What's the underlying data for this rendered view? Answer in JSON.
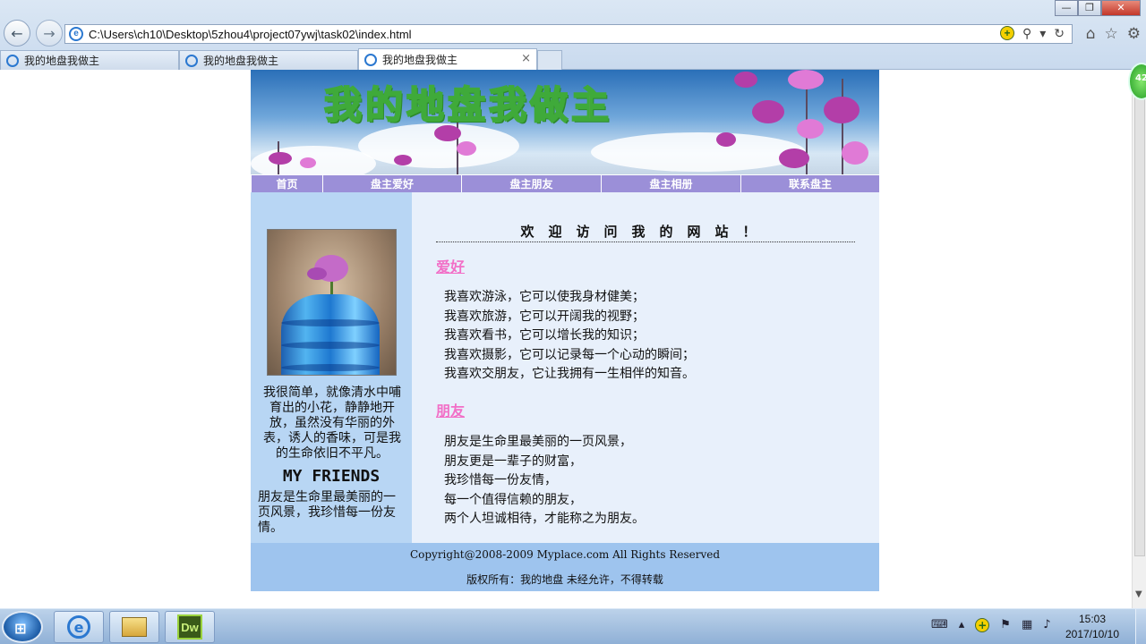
{
  "browser": {
    "address": "C:\\Users\\ch10\\Desktop\\5zhou4\\project07ywj\\task02\\index.html",
    "tabs": [
      {
        "title": "我的地盘我做主"
      },
      {
        "title": "我的地盘我做主"
      },
      {
        "title": "我的地盘我做主"
      }
    ],
    "close_glyph": "×",
    "badge": "42"
  },
  "site": {
    "banner_title": "我的地盘我做主",
    "nav": [
      "首页",
      "盘主爱好",
      "盘主朋友",
      "盘主相册",
      "联系盘主"
    ],
    "sidebar": {
      "intro": "我很简单，就像清水中哺育出的小花，静静地开放，虽然没有华丽的外表，诱人的香味，可是我的生命依旧不平凡。",
      "friends_title": "MY FRIENDS",
      "friends_text": "朋友是生命里最美丽的一页风景，我珍惜每一份友情。"
    },
    "main": {
      "welcome": "欢迎访问我的网站！",
      "hobby_title": "爱好",
      "hobbies": [
        "我喜欢游泳，它可以使我身材健美；",
        "我喜欢旅游，它可以开阔我的视野；",
        "我喜欢看书，它可以增长我的知识；",
        "我喜欢摄影，它可以记录每一个心动的瞬间；",
        "我喜欢交朋友，它让我拥有一生相伴的知音。"
      ],
      "friends_title": "朋友",
      "friends": [
        "朋友是生命里最美丽的一页风景，",
        "朋友更是一辈子的财富，",
        "我珍惜每一份友情，",
        "每一个值得信赖的朋友，",
        "两个人坦诚相待，才能称之为朋友。"
      ]
    },
    "footer": {
      "copyright": "Copyright@2008-2009 Myplace.com All Rights Reserved",
      "notice": "版权所有：我的地盘 未经允许，不得转载"
    }
  },
  "taskbar": {
    "apps": [
      "internet-explorer",
      "file-explorer",
      "dreamweaver"
    ],
    "dw_label": "Dw",
    "time": "15:03",
    "date": "2017/10/10"
  },
  "colors": {
    "nav_bg": "#9b8fd8",
    "sidebar_bg": "#b8d6f4",
    "main_bg": "#e8f0fb",
    "footer_bg": "#9ec4ee",
    "section_title": "#f26fc7"
  }
}
